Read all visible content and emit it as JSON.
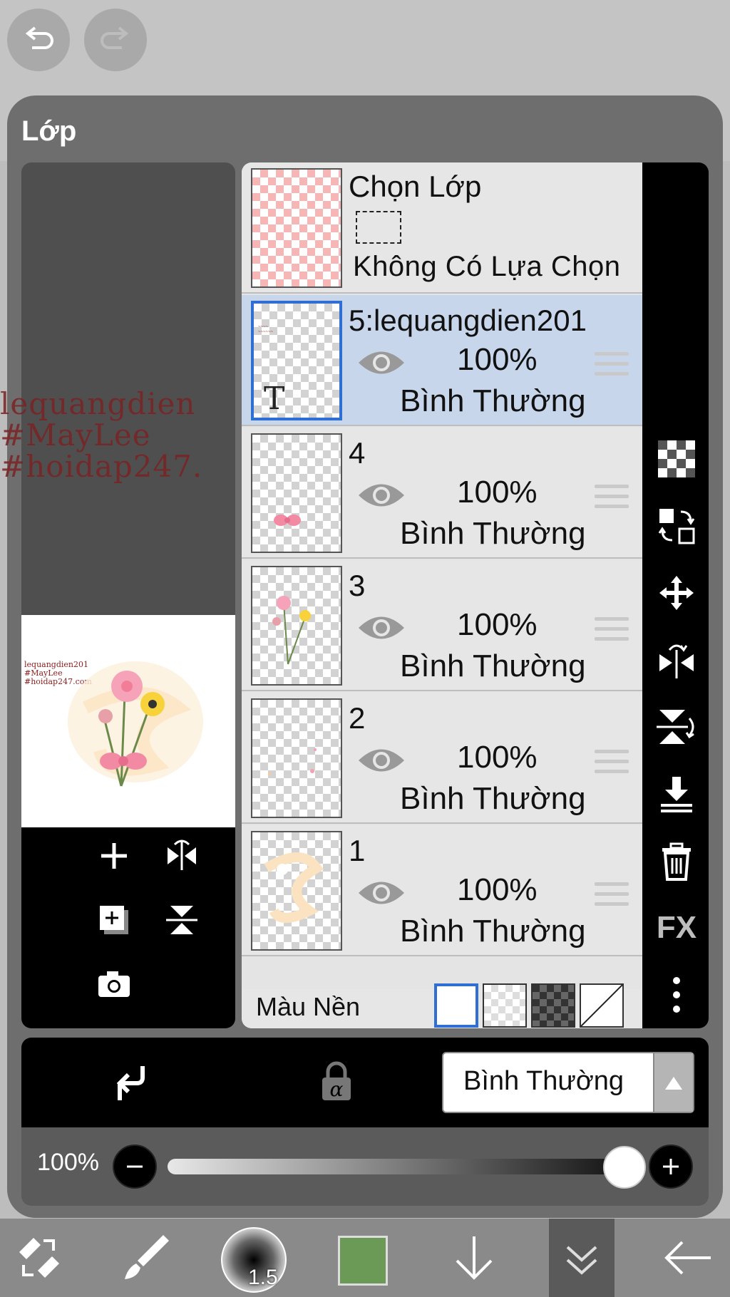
{
  "panel": {
    "title": "Lớp"
  },
  "canvas_bg_text": [
    "lequangdien",
    "#MayLee",
    "#hoidap247."
  ],
  "preview": {
    "watermark": [
      "lequangdien201",
      "#MayLee",
      "#hoidap247.com"
    ]
  },
  "selection_layer": {
    "title": "Chọn Lớp",
    "status": "Không Có Lựa Chọn"
  },
  "layers": [
    {
      "name": "5:lequangdien201",
      "opacity": "100%",
      "blend": "Bình Thường",
      "selected": true,
      "type": "text"
    },
    {
      "name": "4",
      "opacity": "100%",
      "blend": "Bình Thường",
      "selected": false
    },
    {
      "name": "3",
      "opacity": "100%",
      "blend": "Bình Thường",
      "selected": false
    },
    {
      "name": "2",
      "opacity": "100%",
      "blend": "Bình Thường",
      "selected": false
    },
    {
      "name": "1",
      "opacity": "100%",
      "blend": "Bình Thường",
      "selected": false
    }
  ],
  "background": {
    "label": "Màu Nền",
    "options": [
      "white",
      "checker-light",
      "checker-dark",
      "none"
    ],
    "selected": "white"
  },
  "strip_icons": [
    "checker-icon",
    "swap-icon",
    "move-icon",
    "flip-horizontal-icon",
    "flip-vertical-icon",
    "merge-down-icon",
    "trash-icon",
    "FX",
    "more-icon"
  ],
  "action": {
    "blend_mode": "Bình Thường"
  },
  "opacity_slider": {
    "label": "100%",
    "value": 100
  },
  "toolbar": {
    "brush_size": "1.5",
    "color": "#6b9a57"
  },
  "colors": {
    "accent": "#2f6fd3",
    "selected_row": "#c8d6ec"
  }
}
